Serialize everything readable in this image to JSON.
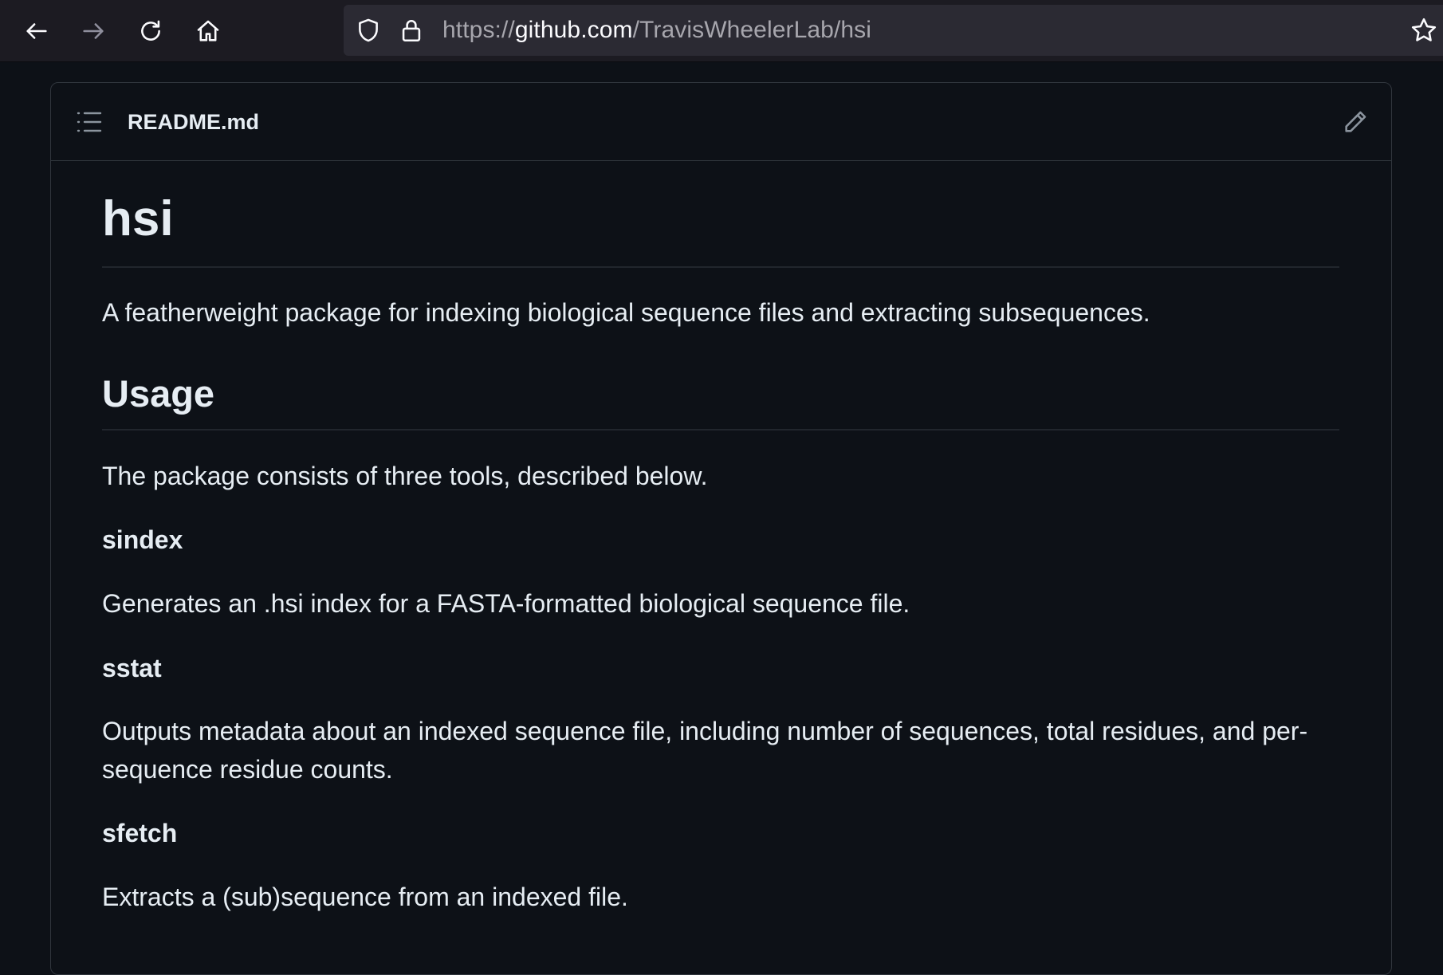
{
  "browser": {
    "url_scheme": "https://",
    "url_host": "github.com",
    "url_path": "/TravisWheelerLab/hsi",
    "icons": [
      "back-arrow-icon",
      "forward-arrow-icon",
      "reload-icon",
      "home-icon",
      "shield-icon",
      "lock-icon",
      "star-icon"
    ]
  },
  "readme": {
    "filename": "README.md",
    "title": "hsi",
    "description": "A featherweight package for indexing biological sequence files and extracting subsequences.",
    "usage_heading": "Usage",
    "usage_intro": "The package consists of three tools, described below.",
    "tools": [
      {
        "name": "sindex",
        "description": "Generates an .hsi index for a FASTA-formatted biological sequence file."
      },
      {
        "name": "sstat",
        "description": "Outputs metadata about an indexed sequence file, including number of sequences, total residues, and per-sequence residue counts."
      },
      {
        "name": "sfetch",
        "description": "Extracts a (sub)sequence from an indexed file."
      }
    ]
  }
}
